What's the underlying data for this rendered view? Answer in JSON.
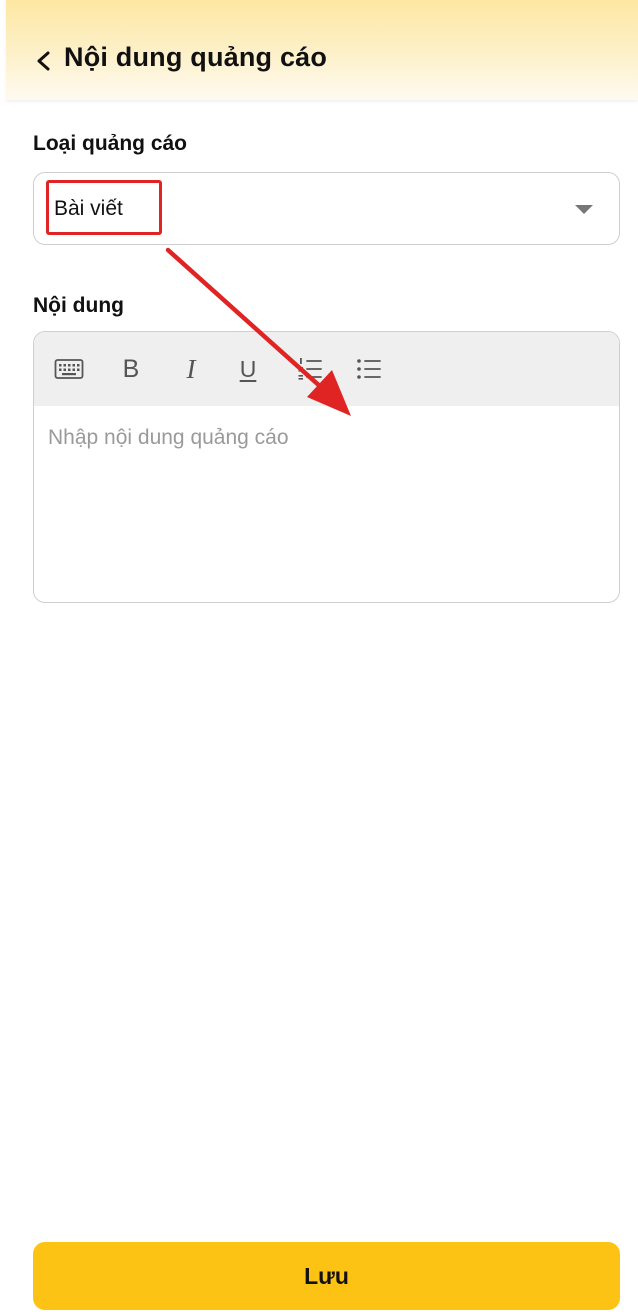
{
  "header": {
    "title": "Nội dung quảng cáo"
  },
  "ad_type": {
    "label": "Loại quảng cáo",
    "selected": "Bài viết"
  },
  "content": {
    "label": "Nội dung",
    "placeholder": "Nhập nội dung quảng cáo",
    "toolbar": {
      "bold": "B",
      "italic": "I",
      "underline": "U"
    }
  },
  "footer": {
    "save_label": "Lưu"
  },
  "colors": {
    "accent": "#fcc314",
    "header_gradient_top": "#fde7a2",
    "annotation": "#e02424"
  },
  "icons": {
    "back": "chevron-left-icon",
    "dropdown": "caret-down-icon",
    "keyboard": "keyboard-icon",
    "ordered_list": "ordered-list-icon",
    "bullet_list": "bullet-list-icon"
  }
}
